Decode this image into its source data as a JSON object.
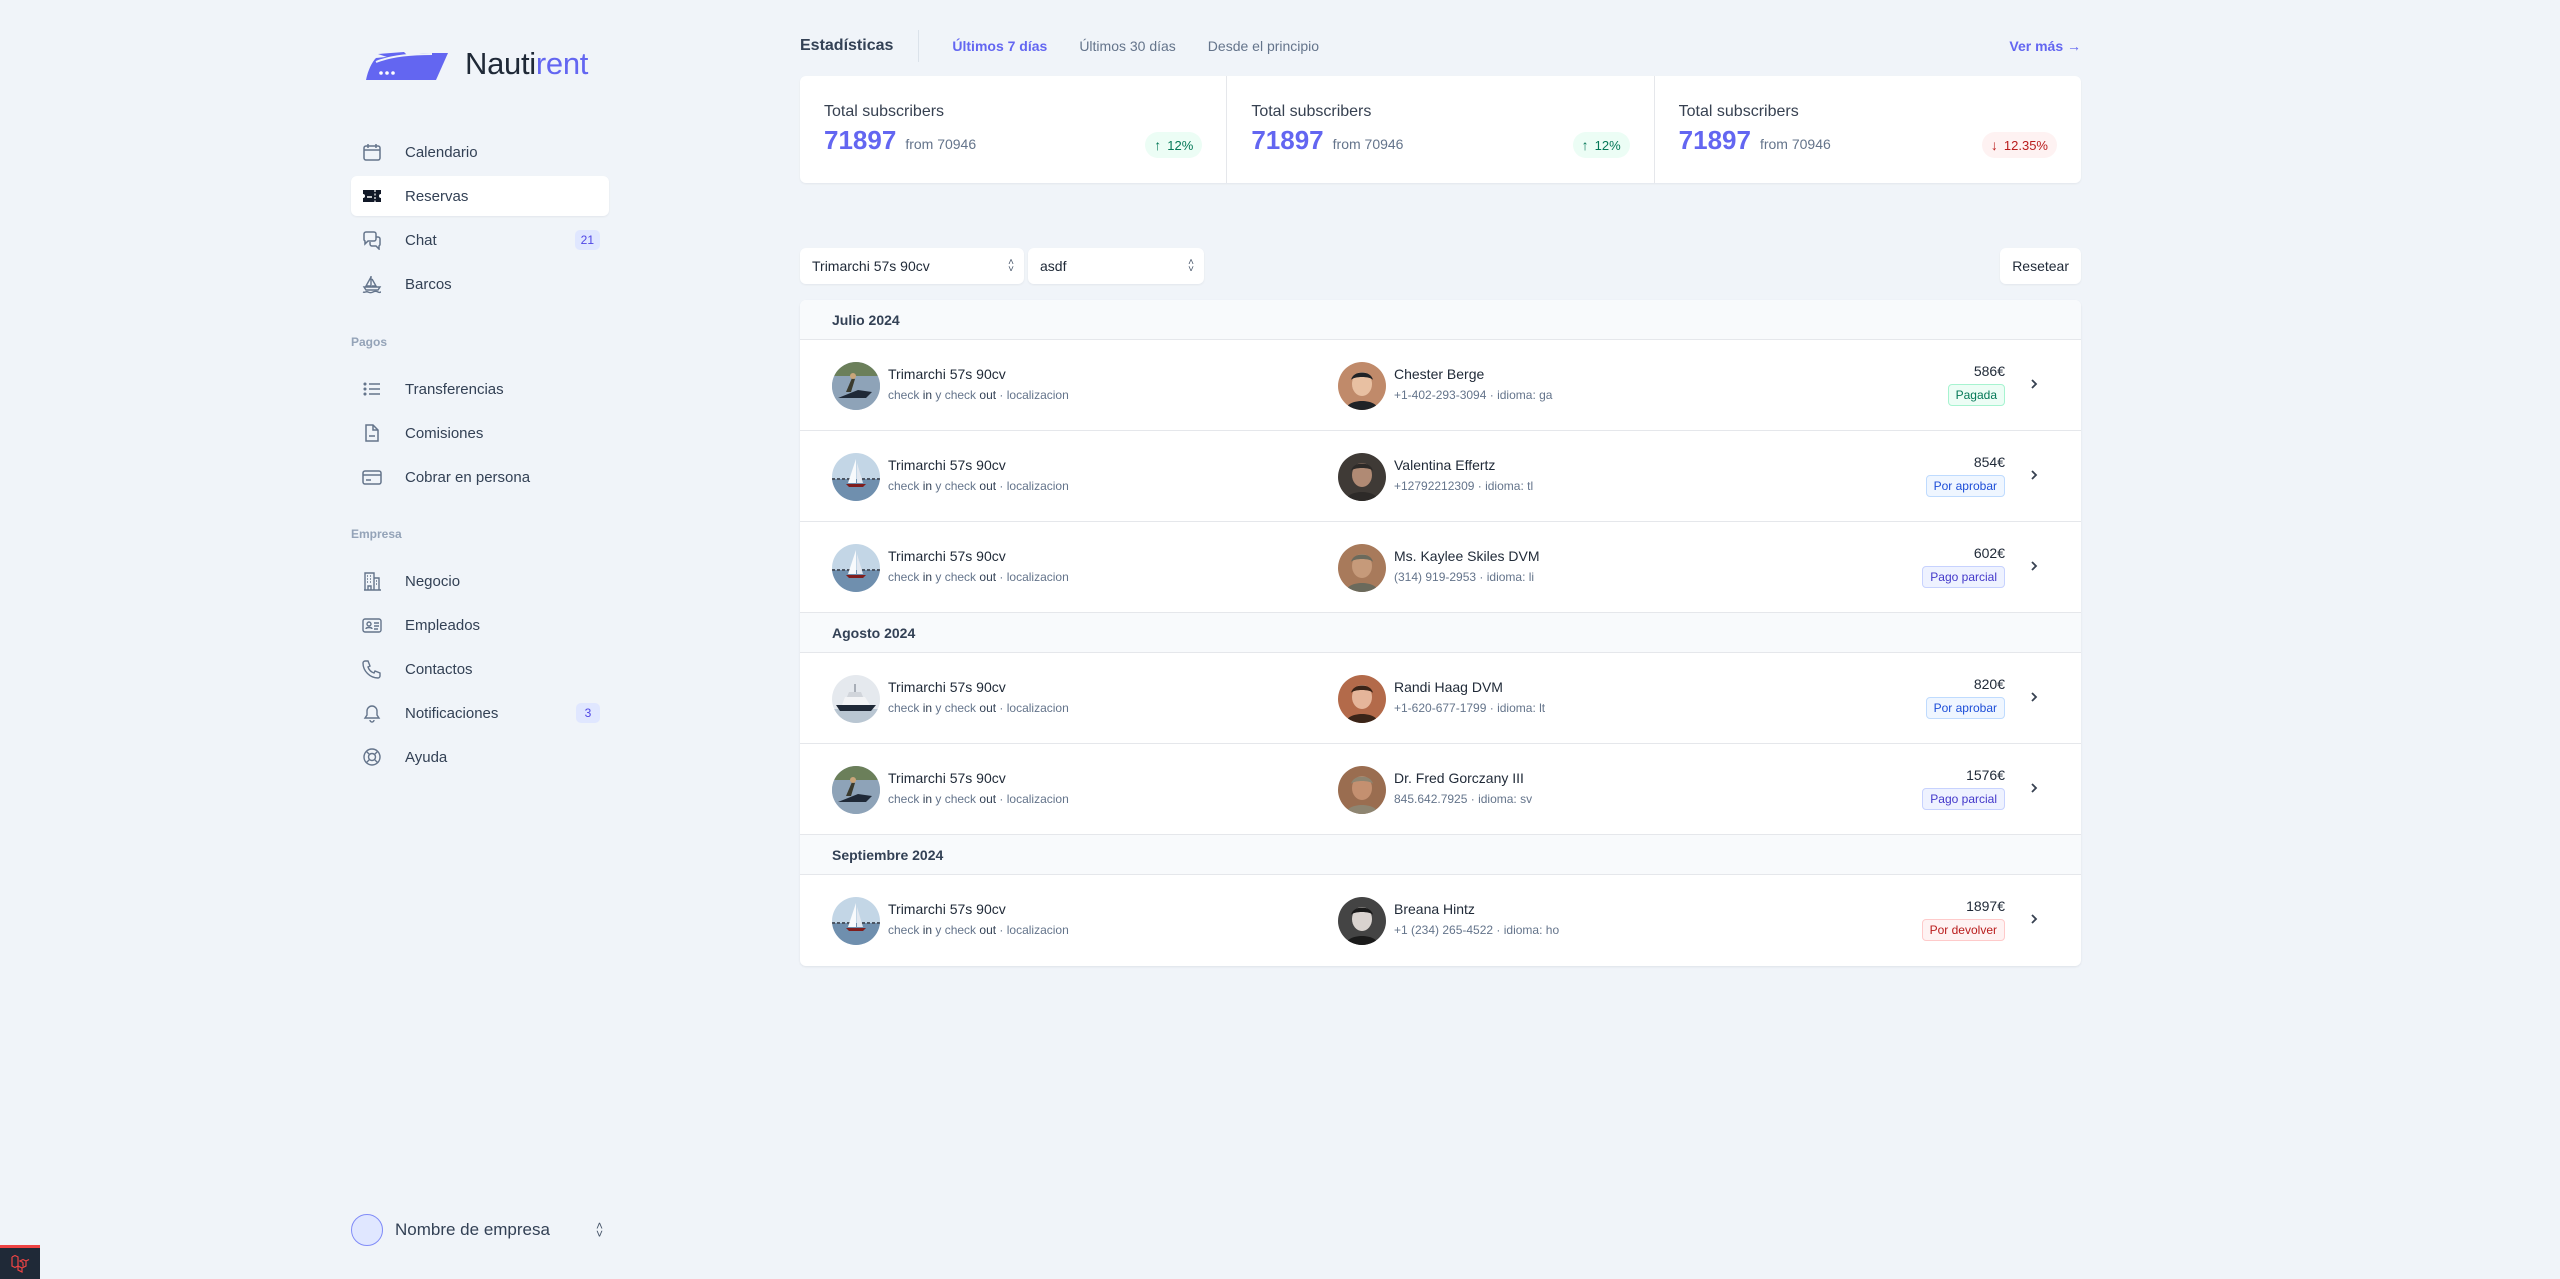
{
  "brand": {
    "name_part1": "Nauti",
    "name_part2": "rent",
    "accent": "#6366f1"
  },
  "sidebar": {
    "main_items": [
      {
        "label": "Calendario",
        "icon": "calendar-icon",
        "active": false
      },
      {
        "label": "Reservas",
        "icon": "ticket-icon",
        "active": true
      },
      {
        "label": "Chat",
        "icon": "chat-bubbles-icon",
        "active": false,
        "count": "21"
      },
      {
        "label": "Barcos",
        "icon": "sailboat-icon",
        "active": false
      }
    ],
    "payments_section": "Pagos",
    "payments_items": [
      {
        "label": "Transferencias",
        "icon": "list-icon"
      },
      {
        "label": "Comisiones",
        "icon": "document-icon"
      },
      {
        "label": "Cobrar en persona",
        "icon": "credit-card-icon"
      }
    ],
    "company_section": "Empresa",
    "company_items": [
      {
        "label": "Negocio",
        "icon": "building-icon"
      },
      {
        "label": "Empleados",
        "icon": "id-card-icon"
      },
      {
        "label": "Contactos",
        "icon": "phone-icon"
      },
      {
        "label": "Notificaciones",
        "icon": "bell-icon",
        "count": "3"
      },
      {
        "label": "Ayuda",
        "icon": "lifebuoy-icon"
      }
    ],
    "company_switcher": {
      "name": "Nombre de empresa"
    }
  },
  "stats": {
    "title": "Estadísticas",
    "tabs": [
      {
        "label": "Últimos 7 días",
        "active": true
      },
      {
        "label": "Últimos 30 días",
        "active": false
      },
      {
        "label": "Desde el principio",
        "active": false
      }
    ],
    "see_more": "Ver más →",
    "cards": [
      {
        "label": "Total subscribers",
        "value": "71897",
        "from": "from 70946",
        "change": "12%",
        "direction": "up"
      },
      {
        "label": "Total subscribers",
        "value": "71897",
        "from": "from 70946",
        "change": "12%",
        "direction": "up"
      },
      {
        "label": "Total subscribers",
        "value": "71897",
        "from": "from 70946",
        "change": "12.35%",
        "direction": "down"
      }
    ]
  },
  "filters": {
    "boat_select": "Trimarchi 57s 90cv",
    "second_select": "asdf",
    "reset_label": "Resetear"
  },
  "bookings": {
    "sub_check_in": "check ",
    "sub_in": "in",
    "sub_y": " y check ",
    "sub_out": "out",
    "sub_loc": " · localizacion",
    "groups": [
      {
        "month": "Julio 2024",
        "rows": [
          {
            "boat": "Trimarchi 57s 90cv",
            "boat_img": "jetski",
            "client": "Chester Berge",
            "phone": "+1-402-293-3094",
            "lang": "idioma: ga",
            "price": "586€",
            "status": "Pagada",
            "status_type": "paid"
          },
          {
            "boat": "Trimarchi 57s 90cv",
            "boat_img": "sailboat",
            "client": "Valentina Effertz",
            "phone": "+12792212309",
            "lang": "idioma: tl",
            "price": "854€",
            "status": "Por aprobar",
            "status_type": "pending"
          },
          {
            "boat": "Trimarchi 57s 90cv",
            "boat_img": "sailboat",
            "client": "Ms. Kaylee Skiles DVM",
            "phone": "(314) 919-2953",
            "lang": "idioma: li",
            "price": "602€",
            "status": "Pago parcial",
            "status_type": "partial"
          }
        ]
      },
      {
        "month": "Agosto 2024",
        "rows": [
          {
            "boat": "Trimarchi 57s 90cv",
            "boat_img": "yacht",
            "client": "Randi Haag DVM",
            "phone": "+1-620-677-1799",
            "lang": "idioma: lt",
            "price": "820€",
            "status": "Por aprobar",
            "status_type": "pending"
          },
          {
            "boat": "Trimarchi 57s 90cv",
            "boat_img": "jetski",
            "client": "Dr. Fred Gorczany III",
            "phone": "845.642.7925",
            "lang": "idioma: sv",
            "price": "1576€",
            "status": "Pago parcial",
            "status_type": "partial"
          }
        ]
      },
      {
        "month": "Septiembre 2024",
        "rows": [
          {
            "boat": "Trimarchi 57s 90cv",
            "boat_img": "sailboat",
            "client": "Breana Hintz",
            "phone": "+1 (234) 265-4522",
            "lang": "idioma: ho",
            "price": "1897€",
            "status": "Por devolver",
            "status_type": "refund"
          }
        ]
      }
    ]
  }
}
